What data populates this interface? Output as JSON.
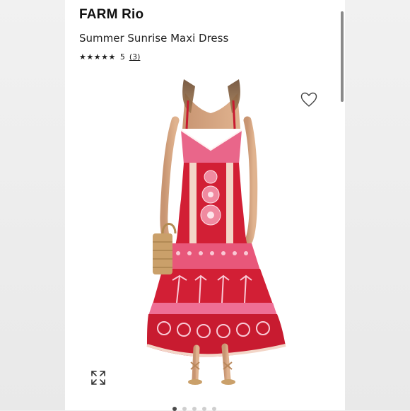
{
  "product": {
    "brand": "FARM Rio",
    "name": "Summer Sunrise Maxi Dress",
    "rating_stars": "★★★★★",
    "rating_value": "5",
    "review_count": "(3)"
  },
  "icons": {
    "favorite": "heart-outline-icon",
    "expand": "expand-arrows-icon"
  },
  "gallery": {
    "image_count": 5,
    "active_index": 0
  },
  "colors": {
    "dress_red": "#d21f35",
    "dress_pink": "#f08aa0",
    "background": "#ffffff"
  }
}
